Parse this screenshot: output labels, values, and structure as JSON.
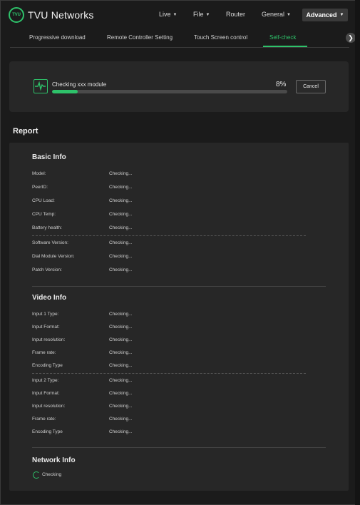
{
  "header": {
    "logo_badge": "TVU",
    "logo_text": "TVU Networks",
    "menu": [
      {
        "label": "Live",
        "has_caret": true
      },
      {
        "label": "File",
        "has_caret": true
      },
      {
        "label": "Router",
        "has_caret": false
      },
      {
        "label": "General",
        "has_caret": true
      },
      {
        "label": "Advanced",
        "has_caret": true
      }
    ]
  },
  "tabs": [
    {
      "label": "Progressive download",
      "active": false
    },
    {
      "label": "Remote Controller Setting",
      "active": false
    },
    {
      "label": "Touch Screen control",
      "active": false
    },
    {
      "label": "Self-check",
      "active": true
    }
  ],
  "progress": {
    "label": "Checking xxx module",
    "percent_text": "8%",
    "fraction": 0.11,
    "cancel_label": "Cancel"
  },
  "report": {
    "title": "Report",
    "basic_info": {
      "title": "Basic Info",
      "rows": [
        {
          "key": "Model:",
          "value": "Checking..."
        },
        {
          "key": "PeerID:",
          "value": "Checking..."
        },
        {
          "key": "CPU Load:",
          "value": "Checking..."
        },
        {
          "key": "CPU Temp:",
          "value": "Checking..."
        },
        {
          "key": "Battery health:",
          "value": "Checking..."
        },
        {
          "key": "Software Version:",
          "value": "Checking..."
        },
        {
          "key": "Dial Module Version:",
          "value": "Checking..."
        },
        {
          "key": "Patch Version:",
          "value": "Checking..."
        }
      ]
    },
    "video_info": {
      "title": "Video Info",
      "rows": [
        {
          "key": "Input 1 Type:",
          "value": "Checking..."
        },
        {
          "key": "Input Format:",
          "value": "Checking..."
        },
        {
          "key": "Input resolution:",
          "value": "Checking..."
        },
        {
          "key": "Frame rate:",
          "value": "Checking..."
        },
        {
          "key": "Encoding Type",
          "value": "Checking..."
        },
        {
          "key": "Input 2 Type:",
          "value": "Checking..."
        },
        {
          "key": "Input Format:",
          "value": "Checking..."
        },
        {
          "key": "Input resolution:",
          "value": "Checking..."
        },
        {
          "key": "Frame rate:",
          "value": "Checking..."
        },
        {
          "key": "Encoding Type",
          "value": "Checking..."
        }
      ]
    },
    "network_info": {
      "title": "Network Info",
      "status": "Checking"
    }
  },
  "colors": {
    "accent": "#2ec26a",
    "background": "#1b1b1b",
    "card": "#272727"
  }
}
